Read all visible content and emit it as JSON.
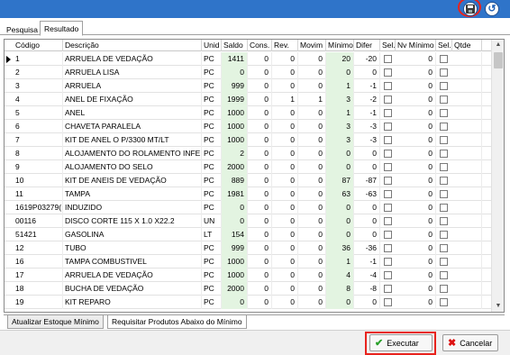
{
  "colors": {
    "topbar": "#2f74c9",
    "highlight": "#e8231d",
    "saldo_bg": "#e3f4e1"
  },
  "toolbar": {
    "save_icon": "save-icon",
    "back_icon": "back-icon"
  },
  "tabs": [
    "Pesquisa",
    "Resultado"
  ],
  "columns": [
    "Código",
    "Descrição",
    "Unid",
    "Saldo",
    "Cons.",
    "Rev.",
    "Movim",
    "Mínimo",
    "Difer",
    "Sel.",
    "Nv Mínimo",
    "Sel.",
    "Qtde"
  ],
  "rows": [
    [
      "1",
      "ARRUELA DE VEDAÇÃO",
      "PC",
      "1411",
      "0",
      "0",
      "0",
      "20",
      "-20",
      "0"
    ],
    [
      "2",
      "ARRUELA  LISA",
      "PC",
      "0",
      "0",
      "0",
      "0",
      "0",
      "0",
      "0"
    ],
    [
      "3",
      "ARRUELA",
      "PC",
      "999",
      "0",
      "0",
      "0",
      "1",
      "-1",
      "0"
    ],
    [
      "4",
      "ANEL DE FIXAÇÃO",
      "PC",
      "1999",
      "0",
      "1",
      "1",
      "3",
      "-2",
      "0"
    ],
    [
      "5",
      "ANEL",
      "PC",
      "1000",
      "0",
      "0",
      "0",
      "1",
      "-1",
      "0"
    ],
    [
      "6",
      "CHAVETA PARALELA",
      "PC",
      "1000",
      "0",
      "0",
      "0",
      "3",
      "-3",
      "0"
    ],
    [
      "7",
      "KIT DE ANEL O P/3300 MT/LT",
      "PC",
      "1000",
      "0",
      "0",
      "0",
      "3",
      "-3",
      "0"
    ],
    [
      "8",
      "ALOJAMENTO DO ROLAMENTO INFER",
      "PC",
      "2",
      "0",
      "0",
      "0",
      "0",
      "0",
      "0"
    ],
    [
      "9",
      "ALOJAMENTO DO SELO",
      "PC",
      "2000",
      "0",
      "0",
      "0",
      "0",
      "0",
      "0"
    ],
    [
      "10",
      "KIT DE ANEIS DE VEDAÇÃO",
      "PC",
      "889",
      "0",
      "0",
      "0",
      "87",
      "-87",
      "0"
    ],
    [
      "11",
      "TAMPA",
      "PC",
      "1981",
      "0",
      "0",
      "0",
      "63",
      "-63",
      "0"
    ],
    [
      "1619P03279(",
      "INDUZIDO",
      "PC",
      "0",
      "0",
      "0",
      "0",
      "0",
      "0",
      "0"
    ],
    [
      "00116",
      "DISCO  CORTE 115 X 1.0 X22.2",
      "UN",
      "0",
      "0",
      "0",
      "0",
      "0",
      "0",
      "0"
    ],
    [
      "51421",
      "GASOLINA",
      "LT",
      "154",
      "0",
      "0",
      "0",
      "0",
      "0",
      "0"
    ],
    [
      "12",
      "TUBO",
      "PC",
      "999",
      "0",
      "0",
      "0",
      "36",
      "-36",
      "0"
    ],
    [
      "16",
      "TAMPA COMBUSTIVEL",
      "PC",
      "1000",
      "0",
      "0",
      "0",
      "1",
      "-1",
      "0"
    ],
    [
      "17",
      "ARRUELA DE VEDAÇÃO",
      "PC",
      "1000",
      "0",
      "0",
      "0",
      "4",
      "-4",
      "0"
    ],
    [
      "18",
      "BUCHA DE VEDAÇÃO",
      "PC",
      "2000",
      "0",
      "0",
      "0",
      "8",
      "-8",
      "0"
    ],
    [
      "19",
      "KIT REPARO",
      "PC",
      "0",
      "0",
      "0",
      "0",
      "0",
      "0",
      "0"
    ]
  ],
  "bottom_tabs": [
    "Atualizar Estoque Mínimo",
    "Requisitar Produtos Abaixo do Mínimo"
  ],
  "buttons": {
    "execute": "Executar",
    "cancel": "Cancelar"
  }
}
